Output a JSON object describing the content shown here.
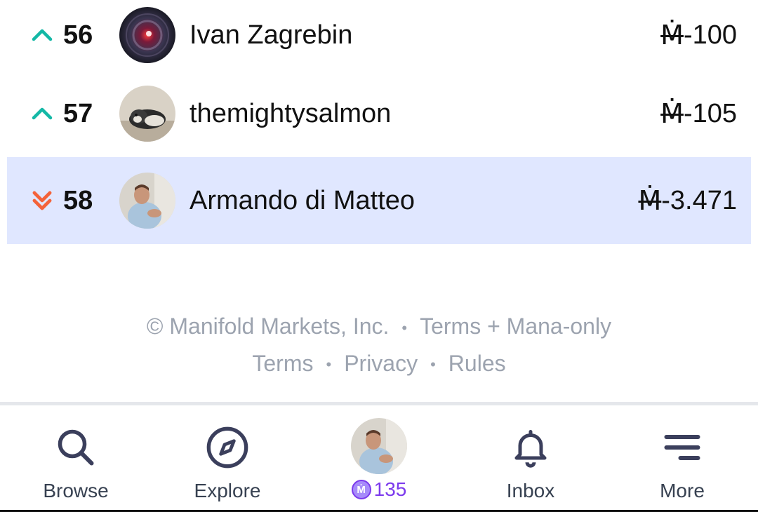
{
  "leaderboard": {
    "rows": [
      {
        "rank": "56",
        "trend": "up",
        "name": "Ivan Zagrebin",
        "currency": "Ṁ",
        "amount": "-100"
      },
      {
        "rank": "57",
        "trend": "up",
        "name": "themightysalmon",
        "currency": "Ṁ",
        "amount": "-105"
      },
      {
        "rank": "58",
        "trend": "down-double",
        "name": "Armando di Matteo",
        "currency": "Ṁ",
        "amount": "-3.471"
      }
    ]
  },
  "footer": {
    "line1": [
      "© Manifold Markets, Inc.",
      "Terms + Mana-only"
    ],
    "line2": [
      "Terms",
      "Privacy",
      "Rules"
    ]
  },
  "nav": {
    "browse": "Browse",
    "explore": "Explore",
    "balance": "135",
    "balance_icon": "Ṁ",
    "inbox": "Inbox",
    "more": "More"
  },
  "colors": {
    "up": "#14b8a6",
    "down": "#f4623a",
    "highlight": "#e0e7ff",
    "footer_text": "#9ca3af",
    "mana_purple": "#7c3aed"
  }
}
